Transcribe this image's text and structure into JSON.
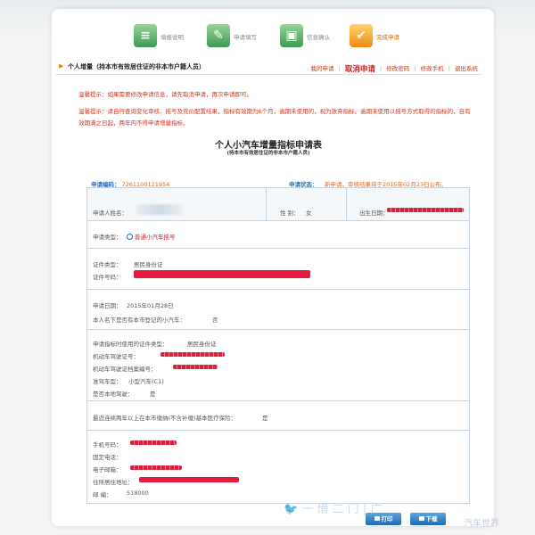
{
  "steps": [
    {
      "label": "填报说明",
      "state": "done",
      "glyph": "≡"
    },
    {
      "label": "申请填写",
      "state": "done",
      "glyph": "✎"
    },
    {
      "label": "信息确认",
      "state": "done",
      "glyph": "▣"
    },
    {
      "label": "完成申请",
      "state": "active",
      "glyph": "✔"
    }
  ],
  "header": {
    "arrow": "▶",
    "title": "个人增量（持本市有效居住证的非本市户籍人员）",
    "nav": {
      "my_application": "我的申请",
      "cancel": "取消申请",
      "change_password": "修改密码",
      "change_phone": "修改手机",
      "logout": "退出系统"
    }
  },
  "tips": [
    "温馨提示：如果需要修改申请信息，请先取消申请，再次申请即可。",
    "温馨提示：请自行查询变化审核、摇号及竞价配置结果，指标有效期为6个月，逾期未使用的，视为放弃指标。逾期未使用以摇号方式取得的指标的，自有效期满之日起，两年内不得申请增量指标。"
  ],
  "form": {
    "title": "个人小汽车增量指标申请表",
    "subtitle": "(持本市有效居住证的非本市户籍人员)",
    "application_code_label": "申请编码：",
    "application_code": "7261100121954",
    "status_label": "申请状态：",
    "status_value": "新申请，审核结果将于2015年02月23日公布。",
    "applicant_name_label": "申请人姓名：",
    "gender_label": "性    别：",
    "gender_value": "女",
    "birth_label": "出生日期：",
    "apply_type_label": "申请类型：",
    "apply_type_value": "普通小汽车摇号",
    "id_type_label": "证件类型：",
    "id_type_value": "居民身份证",
    "id_number_label": "证件号码：",
    "apply_date_label": "申请日期：",
    "apply_date_value": "2015年01月28日",
    "has_car_question": "本人名下是否有本市登记的小汽车：",
    "has_car_value": "否",
    "reg_id_type_label": "申请指标时使用的证件类型：",
    "reg_id_type_value": "居民身份证",
    "license_no_label": "机动车驾驶证号：",
    "license_file_label": "机动车驾驶证档案编号：",
    "license_class_label": "准驾车型：",
    "license_class_value": "小型汽车(C1)",
    "local_license_label": "是否本地驾驶：",
    "local_license_value": "是",
    "insurance_question": "最近连续两年以上在本市缴纳(不含补缴)基本医疗保险：",
    "insurance_value": "是",
    "mobile_label": "手机号码：",
    "phone_label": "固定电话：",
    "email_label": "电子邮箱：",
    "address_label": "住所居住地址：",
    "postcode_label": "邮    编：",
    "postcode_value": "518000"
  },
  "buttons": {
    "print": "打印",
    "download": "下载"
  },
  "watermark": {
    "left": "🐦 一 借 二 门 | 广",
    "right": "汽车世界"
  }
}
